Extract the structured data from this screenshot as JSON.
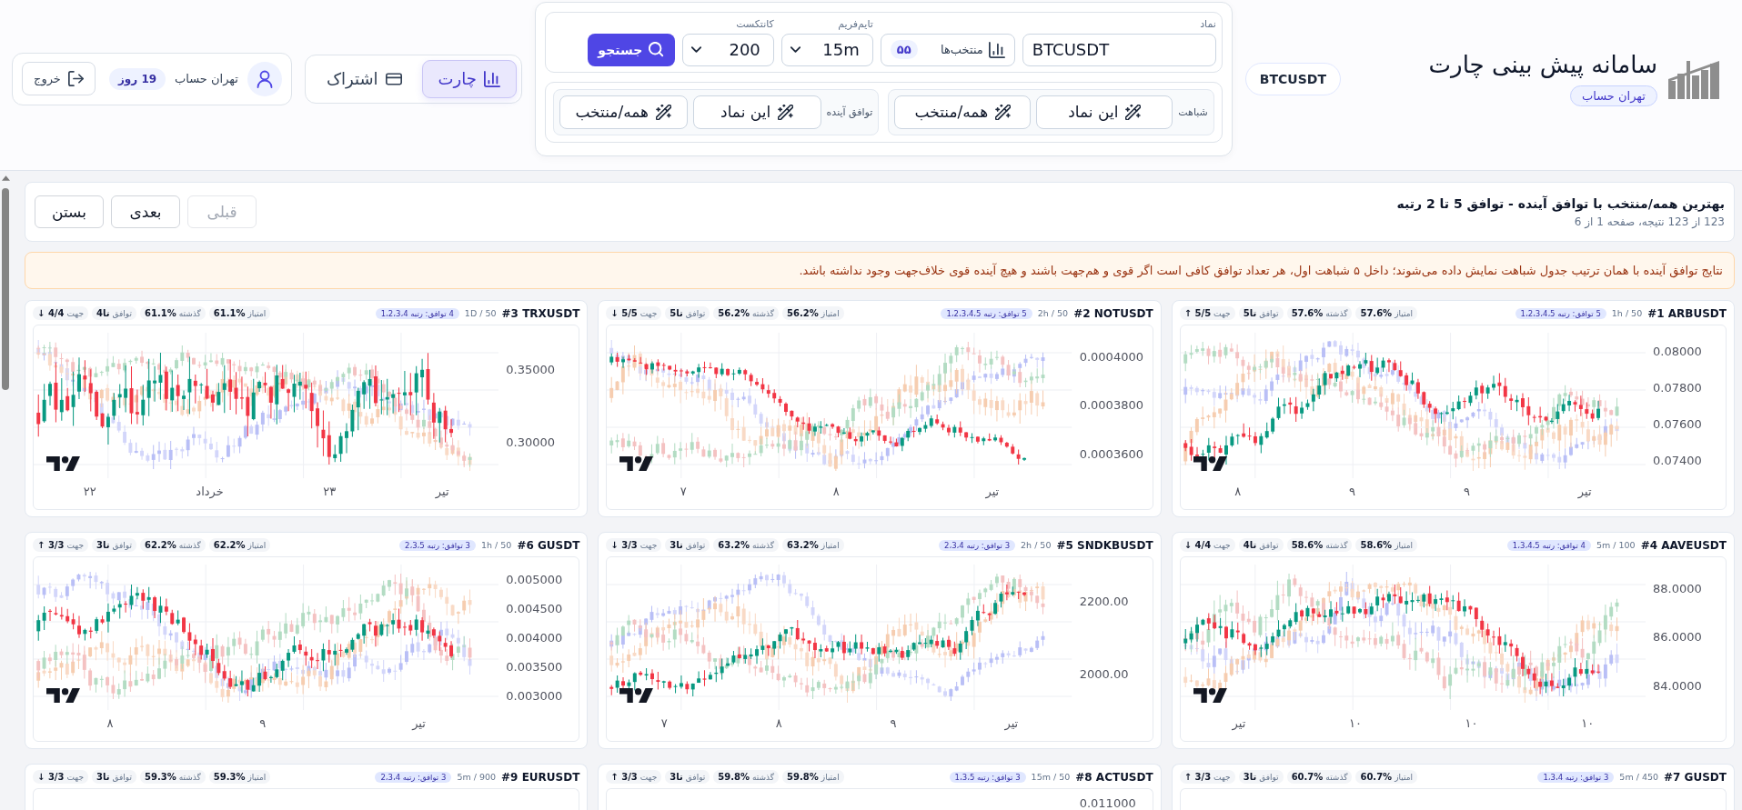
{
  "header": {
    "brand": {
      "title": "سامانه پیش بینی چارت",
      "badge": "تهران حساب"
    },
    "current_symbol": "BTCUSDT",
    "search_panel": {
      "symbol": {
        "label": "نماد",
        "value": "BTCUSDT"
      },
      "favorites": {
        "label": "منتخب‌ها",
        "count": "۵۵"
      },
      "timeframe": {
        "label": "تایم‌فریم",
        "value": "15m"
      },
      "context": {
        "label": "کانتکست",
        "value": "200"
      },
      "search_button": "جستجو",
      "action_groups": [
        {
          "label": "شباهت",
          "buttons": [
            "این نماد",
            "همه/منتخب"
          ]
        },
        {
          "label": "توافق آینده",
          "buttons": [
            "این نماد",
            "همه/منتخب"
          ]
        }
      ]
    },
    "nav_tabs": [
      {
        "label": "چارت",
        "selected": true
      },
      {
        "label": "اشتراک",
        "selected": false
      }
    ],
    "user": {
      "name": "تهران حساب",
      "days_left": "19 روز",
      "logout": "خروج"
    }
  },
  "results": {
    "title": "بهترین همه/منتخب با توافق آینده - توافق 5 تا 2 رتبه",
    "summary": "123 از 123 نتیجه، صفحه 1 از 6",
    "buttons": [
      {
        "label": "قبلی",
        "disabled": true
      },
      {
        "label": "بعدی",
        "disabled": false
      },
      {
        "label": "بستن",
        "disabled": false
      }
    ]
  },
  "notice": "نتایج توافق آینده با همان ترتیب جدول شباهت نمایش داده می‌شوند؛ داخل ۵ شباهت اول، هر تعداد توافق کافی است اگر قوی و هم‌جهت باشند و هیچ آینده قوی خلاف‌جهت وجود نداشته باشد.",
  "cards": [
    {
      "title": "#1 ARBUSDT",
      "meta": "1h / 50",
      "badge": "5 توافق: رتبه 1،2،3،4،5",
      "stats": [
        {
          "label": "امتیاز",
          "value": "57.6%"
        },
        {
          "label": "گذشته",
          "value": "57.6%"
        },
        {
          "label": "توافق",
          "value": "5تا"
        },
        {
          "label": "جهت",
          "value": "↑ 5/5"
        }
      ],
      "chart": {
        "y_axis_labels": [
          "0.08000",
          "0.07800",
          "0.07600",
          "0.07400"
        ],
        "x_axis_labels": [
          "تیر",
          "۹",
          "۹",
          "۸"
        ]
      }
    },
    {
      "title": "#2 NOTUSDT",
      "meta": "2h / 50",
      "badge": "5 توافق: رتبه 1،2،3،4،5",
      "stats": [
        {
          "label": "امتیاز",
          "value": "56.2%"
        },
        {
          "label": "گذشته",
          "value": "56.2%"
        },
        {
          "label": "توافق",
          "value": "5تا"
        },
        {
          "label": "جهت",
          "value": "↓ 5/5"
        }
      ],
      "chart": {
        "y_axis_labels": [
          "0.0004000",
          "0.0003800",
          "0.0003600"
        ],
        "x_axis_labels": [
          "تیر",
          "۸",
          "۷"
        ]
      }
    },
    {
      "title": "#3 TRXUSDT",
      "meta": "1D / 50",
      "badge": "4 توافق: رتبه 1،2،3،4",
      "stats": [
        {
          "label": "امتیاز",
          "value": "61.1%"
        },
        {
          "label": "گذشته",
          "value": "61.1%"
        },
        {
          "label": "توافق",
          "value": "4تا"
        },
        {
          "label": "جهت",
          "value": "↓ 4/4"
        }
      ],
      "chart": {
        "y_axis_labels": [
          "0.35000",
          "0.30000"
        ],
        "x_axis_labels": [
          "تیر",
          "۲۳",
          "خرداد",
          "۲۲"
        ]
      }
    },
    {
      "title": "#4 AAVEUSDT",
      "meta": "5m / 100",
      "badge": "4 توافق: رتبه 1،3،4،5",
      "stats": [
        {
          "label": "امتیاز",
          "value": "58.6%"
        },
        {
          "label": "گذشته",
          "value": "58.6%"
        },
        {
          "label": "توافق",
          "value": "4تا"
        },
        {
          "label": "جهت",
          "value": "↓ 4/4"
        }
      ],
      "chart": {
        "y_axis_labels": [
          "88.0000",
          "86.0000",
          "84.0000"
        ],
        "x_axis_labels": [
          "۱۰",
          "۱۰",
          "۱۰",
          "تیر"
        ]
      }
    },
    {
      "title": "#5 SNDKBUSDT",
      "meta": "2h / 50",
      "badge": "3 توافق: رتبه 2،3،4",
      "stats": [
        {
          "label": "امتیاز",
          "value": "63.2%"
        },
        {
          "label": "گذشته",
          "value": "63.2%"
        },
        {
          "label": "توافق",
          "value": "3تا"
        },
        {
          "label": "جهت",
          "value": "↓ 3/3"
        }
      ],
      "chart": {
        "y_axis_labels": [
          "2200.00",
          "2000.00"
        ],
        "x_axis_labels": [
          "تیر",
          "۹",
          "۸",
          "۷"
        ]
      }
    },
    {
      "title": "#6 GUSDT",
      "meta": "1h / 50",
      "badge": "3 توافق: رتبه 2،3،5",
      "stats": [
        {
          "label": "امتیاز",
          "value": "62.2%"
        },
        {
          "label": "گذشته",
          "value": "62.2%"
        },
        {
          "label": "توافق",
          "value": "3تا"
        },
        {
          "label": "جهت",
          "value": "↑ 3/3"
        }
      ],
      "chart": {
        "y_axis_labels": [
          "0.005000",
          "0.004500",
          "0.004000",
          "0.003500",
          "0.003000"
        ],
        "x_axis_labels": [
          "تیر",
          "۹",
          "۸"
        ]
      }
    },
    {
      "title": "#7 GUSDT",
      "meta": "5m / 450",
      "badge": "3 توافق: رتبه 1،3،4",
      "stats": [
        {
          "label": "امتیاز",
          "value": "60.7%"
        },
        {
          "label": "گذشته",
          "value": "60.7%"
        },
        {
          "label": "توافق",
          "value": "3تا"
        },
        {
          "label": "جهت",
          "value": "↑ 3/3"
        }
      ]
    },
    {
      "title": "#8 ACTUSDT",
      "meta": "15m / 50",
      "badge": "3 توافق: رتبه 1،3،5",
      "stats": [
        {
          "label": "امتیاز",
          "value": "59.8%"
        },
        {
          "label": "گذشته",
          "value": "59.8%"
        },
        {
          "label": "توافق",
          "value": "3تا"
        },
        {
          "label": "جهت",
          "value": "↑ 3/3"
        }
      ],
      "chart": {
        "y_axis_labels": [
          "0.011000"
        ]
      }
    },
    {
      "title": "#9 EURUSDT",
      "meta": "5m / 900",
      "badge": "3 توافق: رتبه 2،3،4",
      "stats": [
        {
          "label": "امتیاز",
          "value": "59.3%"
        },
        {
          "label": "گذشته",
          "value": "59.3%"
        },
        {
          "label": "توافق",
          "value": "3تا"
        },
        {
          "label": "جهت",
          "value": "↓ 3/3"
        }
      ]
    }
  ]
}
